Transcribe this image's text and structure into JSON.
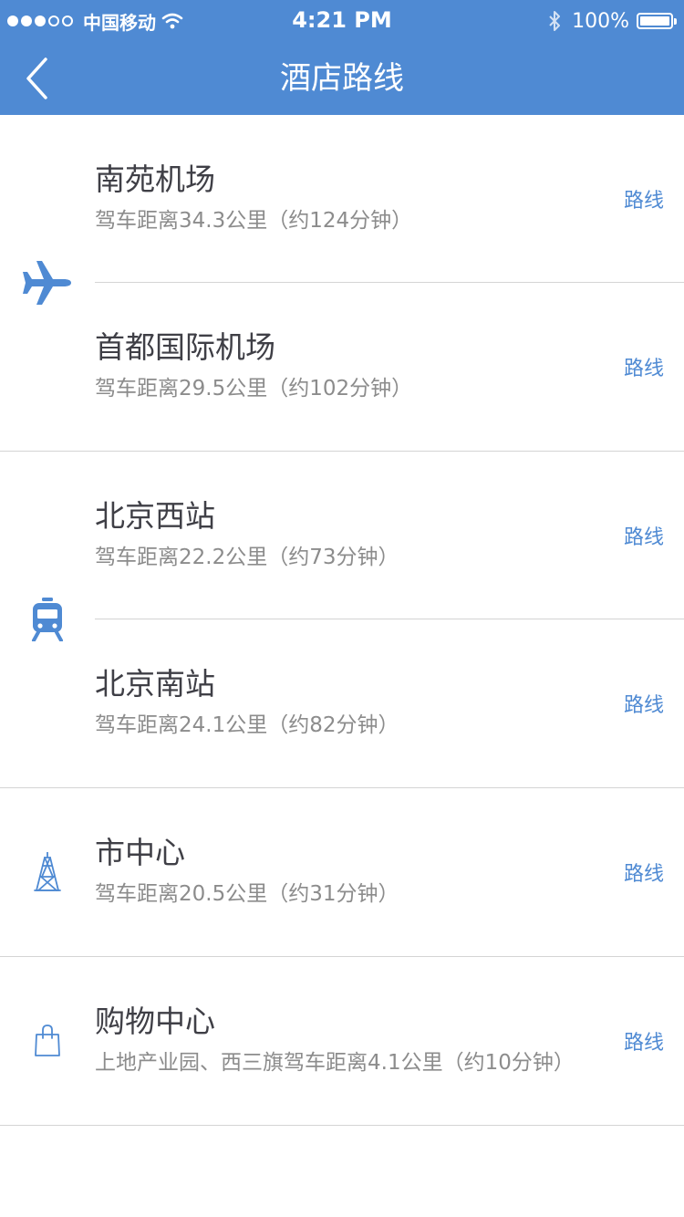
{
  "status_bar": {
    "carrier": "中国移动",
    "time": "4:21 PM",
    "battery": "100%",
    "signal_icon": "signal-dots-icon",
    "wifi_icon": "wifi-icon",
    "bluetooth_icon": "bluetooth-icon",
    "battery_icon": "battery-icon"
  },
  "nav": {
    "title": "酒店路线",
    "back_icon": "chevron-left-icon"
  },
  "colors": {
    "accent": "#4f8ad3",
    "title_text": "#3f3f46",
    "sub_text": "#8c8c8c",
    "divider": "#d4d4d4"
  },
  "groups": [
    {
      "icon": "airplane-icon",
      "items": [
        {
          "title": "南苑机场",
          "subtitle": "驾车距离34.3公里（约124分钟）",
          "action": "路线"
        },
        {
          "title": "首都国际机场",
          "subtitle": "驾车距离29.5公里（约102分钟）",
          "action": "路线"
        }
      ]
    },
    {
      "icon": "train-icon",
      "items": [
        {
          "title": "北京西站",
          "subtitle": "驾车距离22.2公里（约73分钟）",
          "action": "路线"
        },
        {
          "title": "北京南站",
          "subtitle": "驾车距离24.1公里（约82分钟）",
          "action": "路线"
        }
      ]
    },
    {
      "icon": "tower-icon",
      "items": [
        {
          "title": "市中心",
          "subtitle": "驾车距离20.5公里（约31分钟）",
          "action": "路线"
        }
      ]
    },
    {
      "icon": "shopping-bag-icon",
      "items": [
        {
          "title": "购物中心",
          "subtitle": "上地产业园、西三旗驾车距离4.1公里（约10分钟）",
          "action": "路线"
        }
      ]
    }
  ]
}
